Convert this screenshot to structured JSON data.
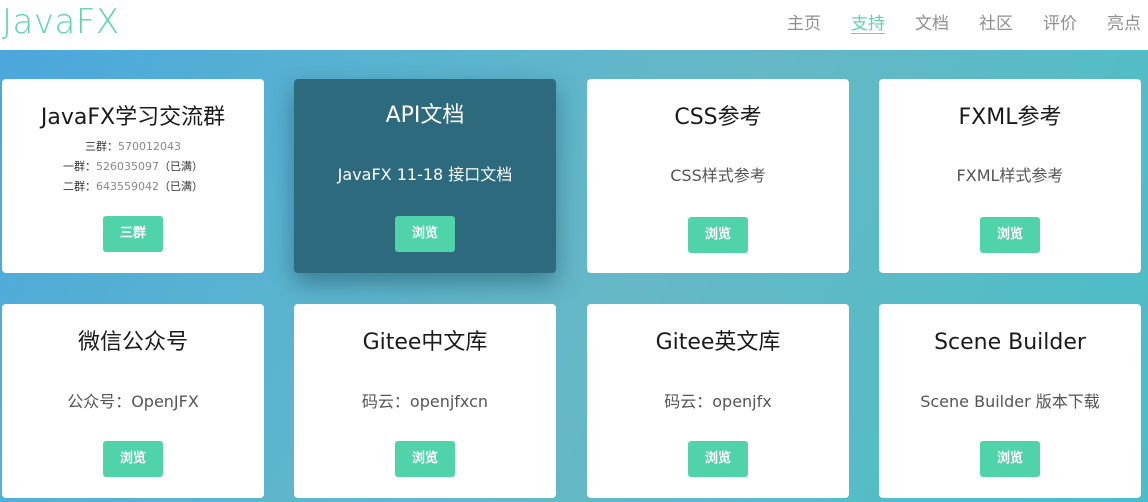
{
  "header": {
    "brand": "JavaFX",
    "nav": [
      "主页",
      "支持",
      "文档",
      "社区",
      "评价",
      "亮点"
    ],
    "active_index": 1
  },
  "colors": {
    "accent": "#51d3aa",
    "brand": "#5cd4ac",
    "dark_card": "#2d6a7e"
  },
  "cards": [
    {
      "title": "JavaFX学习交流群",
      "groups": [
        {
          "label": "三群：",
          "num": "570012043",
          "note": ""
        },
        {
          "label": "一群：",
          "num": "526035097",
          "note": "（已满）"
        },
        {
          "label": "二群：",
          "num": "643559042",
          "note": "（已满）"
        }
      ],
      "button": "三群"
    },
    {
      "title": "API文档",
      "desc": "JavaFX 11-18 接口文档",
      "button": "浏览"
    },
    {
      "title": "CSS参考",
      "desc": "CSS样式参考",
      "button": "浏览"
    },
    {
      "title": "FXML参考",
      "desc": "FXML样式参考",
      "button": "浏览"
    },
    {
      "title": "微信公众号",
      "desc": "公众号：OpenJFX",
      "button": "浏览"
    },
    {
      "title": "Gitee中文库",
      "desc": "码云：openjfxcn",
      "button": "浏览"
    },
    {
      "title": "Gitee英文库",
      "desc": "码云：openjfx",
      "button": "浏览"
    },
    {
      "title": "Scene Builder",
      "desc": "Scene Builder 版本下载",
      "button": "浏览"
    }
  ]
}
